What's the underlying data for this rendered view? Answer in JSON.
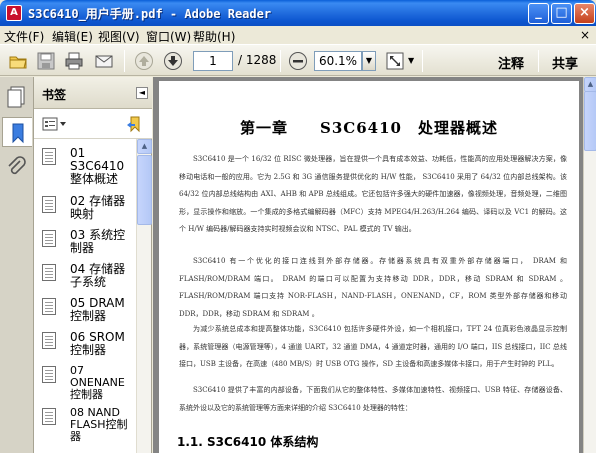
{
  "window": {
    "title": "S3C6410_用户手册.pdf - Adobe Reader",
    "app_icon": "A",
    "buttons": {
      "minimize": "_",
      "maximize": "□",
      "close": "×"
    }
  },
  "menu": {
    "items": [
      "文件(F)",
      "编辑(E)",
      "视图(V)",
      "窗口(W)",
      "帮助(H)"
    ],
    "close_glyph": "×"
  },
  "toolbar": {
    "current_page": "1",
    "page_total": "/ 1288",
    "zoom": "60.1%",
    "annotate_label": "注释",
    "share_label": "共享"
  },
  "bookmarks": {
    "title": "书签",
    "collapse_glyph": "◄",
    "items": [
      {
        "label": "01 S3C6410整体概述"
      },
      {
        "label": "02 存储器映射"
      },
      {
        "label": "03 系统控制器"
      },
      {
        "label": "04 存储器子系统"
      },
      {
        "label": "05 DRAM 控制器"
      },
      {
        "label": "06 SROM 控制器"
      },
      {
        "label": "07 ONENANE控制器"
      },
      {
        "label": "08 NAND FLASH控制器"
      }
    ]
  },
  "document": {
    "chapter_title": "第一章　　S3C6410　处理器概述",
    "paragraphs": [
      "S3C6410 是一个 16/32 位 RISC 微处理器，旨在提供一个具有成本效益、功耗低，性能高的应用处理器解决方案，像移动电话和一般的应用。它为 2.5G 和 3G 通信服务提供优化的 H/W 性能， S3C6410 采用了 64/32 位内部总线架构。该 64/32 位内部总线结构由 AXI、AHB 和 APB 总线组成。它还包括许多强大的硬件加速器，像视频处理，音频处理，二维图形，显示操作和缩放。一个集成的多格式编解码器（MFC）支持 MPEG4/H.263/H.264 编码、译码以及 VC1 的解码。这个 H/W 编码器/解码器支持实时视频会议和 NTSC、PAL 模式的 TV 输出。",
      "S3C6410 有一个优化的接口连线到外部存储器。存储器系统具有双重外部存储器端口， DRAM 和 FLASH/ROM/DRAM 端口。 DRAM 的端口可以配置为支持移动 DDR，DDR，移动 SDRAM 和 SDRAM 。FLASH/ROM/DRAM 端口支持 NOR-FLASH，NAND-FLASH，ONENAND，CF，ROM 类型外部存储器和移动 DDR，DDR，移动 SDRAM 和 SDRAM 。",
      "为减少系统总成本和提高整体功能，S3C6410 包括许多硬件外设，如一个相机接口，TFT 24 位真彩色液晶显示控制器，系统管理器（电源管理等），4 通道 UART，32 通道 DMA，4 通道定时器，通用的 I/O 端口，IIS 总线接口，IIC 总线接口，USB 主设备，在高速（480 MB/S）时 USB OTG 操作，SD 主设备和高速多媒体卡接口，用于产生时钟的 PLL。",
      "S3C6410 提供了丰富的内部设备，下面我们从它的整体特性、多媒体加速特性、视频接口、USB 特征、存储器设备、系统外设以及它的系统管理等方面来详细的介绍 S3C6410 处理器的特性："
    ],
    "section_heading": "1.1. S3C6410 体系结构"
  },
  "colors": {
    "titlebar": "#0b4fc4",
    "doc_background": "#848484",
    "panel": "#ece9d8"
  }
}
